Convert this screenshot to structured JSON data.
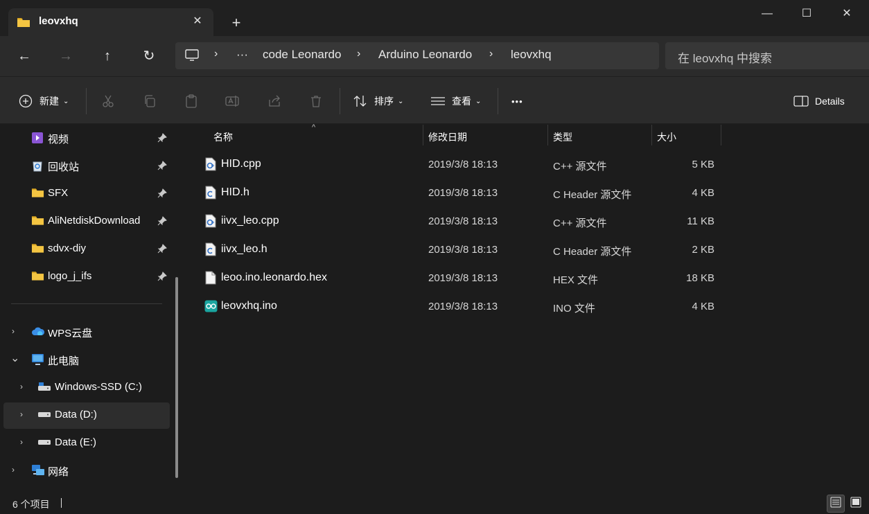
{
  "tab": {
    "title": "leovxhq",
    "close_glyph": "✕",
    "newtab_glyph": "+"
  },
  "window": {
    "minimize_glyph": "—",
    "maximize_glyph": "☐",
    "close_glyph": "✕"
  },
  "nav": {
    "back_glyph": "←",
    "forward_glyph": "→",
    "up_glyph": "↑",
    "refresh_glyph": "↻"
  },
  "breadcrumb": {
    "overflow": "···",
    "separator": "›",
    "items": [
      "code Leonardo",
      "Arduino Leonardo",
      "leovxhq"
    ]
  },
  "search": {
    "placeholder": "在 leovxhq 中搜索"
  },
  "toolbar": {
    "new_label": "新建",
    "sort_label": "排序",
    "view_label": "查看",
    "more_glyph": "•••",
    "details_label": "Details"
  },
  "sidebar": {
    "pinned": [
      {
        "label": "视频",
        "icon": "video-icon"
      },
      {
        "label": "回收站",
        "icon": "recycle-bin-icon"
      },
      {
        "label": "SFX",
        "icon": "folder-icon"
      },
      {
        "label": "AliNetdiskDownload",
        "icon": "folder-icon"
      },
      {
        "label": "sdvx-diy",
        "icon": "folder-icon"
      },
      {
        "label": "logo_j_ifs",
        "icon": "folder-icon"
      }
    ],
    "tree": [
      {
        "label": "WPS云盘",
        "icon": "cloud-icon",
        "chevron": "›"
      },
      {
        "label": "此电脑",
        "icon": "computer-icon",
        "chevron": "⌄"
      },
      {
        "label": "Windows-SSD (C:)",
        "icon": "drive-icon",
        "chevron": "›"
      },
      {
        "label": "Data (D:)",
        "icon": "drive-icon",
        "chevron": "›",
        "selected": true
      },
      {
        "label": "Data (E:)",
        "icon": "drive-icon",
        "chevron": "›"
      },
      {
        "label": "网络",
        "icon": "network-icon",
        "chevron": "›"
      }
    ]
  },
  "columns": {
    "name": "名称",
    "modified": "修改日期",
    "type": "类型",
    "size": "大小",
    "sort_glyph": "^"
  },
  "files": [
    {
      "name": "HID.cpp",
      "modified": "2019/3/8 18:13",
      "type": "C++ 源文件",
      "size": "5 KB",
      "icon": "cpp-file-icon"
    },
    {
      "name": "HID.h",
      "modified": "2019/3/8 18:13",
      "type": "C Header 源文件",
      "size": "4 KB",
      "icon": "header-file-icon"
    },
    {
      "name": "iivx_leo.cpp",
      "modified": "2019/3/8 18:13",
      "type": "C++ 源文件",
      "size": "11 KB",
      "icon": "cpp-file-icon"
    },
    {
      "name": "iivx_leo.h",
      "modified": "2019/3/8 18:13",
      "type": "C Header 源文件",
      "size": "2 KB",
      "icon": "header-file-icon"
    },
    {
      "name": "leoo.ino.leonardo.hex",
      "modified": "2019/3/8 18:13",
      "type": "HEX 文件",
      "size": "18 KB",
      "icon": "blank-file-icon"
    },
    {
      "name": "leovxhq.ino",
      "modified": "2019/3/8 18:13",
      "type": "INO 文件",
      "size": "4 KB",
      "icon": "arduino-file-icon"
    }
  ],
  "status": {
    "count": "6 个项目"
  },
  "colors": {
    "folder": "#f4c542",
    "accent": "#60cdff",
    "arduino": "#1aa5a0"
  }
}
